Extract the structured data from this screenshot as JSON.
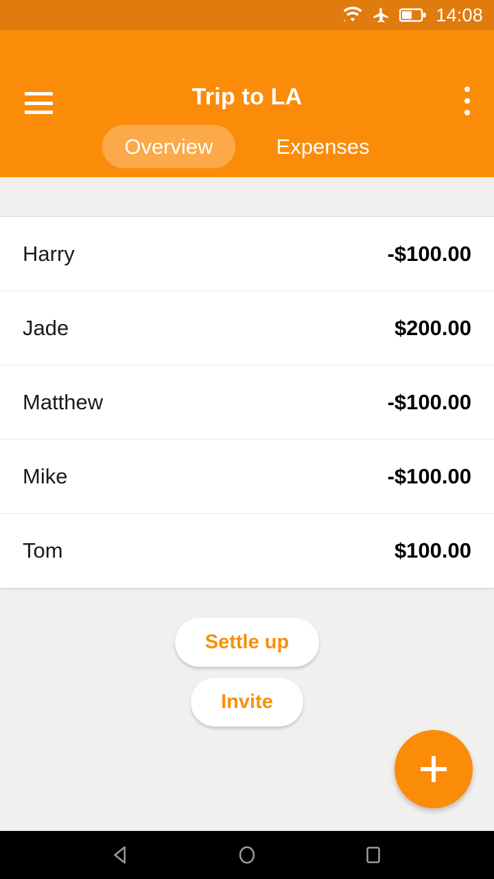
{
  "status_bar": {
    "time": "14:08",
    "icons": [
      "wifi-icon",
      "airplane-mode-icon",
      "battery-icon"
    ],
    "background": "#E07B0E"
  },
  "app_bar": {
    "title": "Trip to LA",
    "menu_icon": "hamburger-menu-icon",
    "overflow_icon": "overflow-menu-icon",
    "background": "#FB8C0A",
    "tabs": [
      {
        "label": "Overview",
        "selected": true
      },
      {
        "label": "Expenses",
        "selected": false
      }
    ]
  },
  "balances": {
    "rows": [
      {
        "name": "Harry",
        "amount": "-$100.00"
      },
      {
        "name": "Jade",
        "amount": "$200.00"
      },
      {
        "name": "Matthew",
        "amount": "-$100.00"
      },
      {
        "name": "Mike",
        "amount": "-$100.00"
      },
      {
        "name": "Tom",
        "amount": "$100.00"
      }
    ]
  },
  "actions": {
    "settle_up_label": "Settle up",
    "invite_label": "Invite",
    "accent_color": "#F7900B"
  },
  "fab": {
    "icon": "plus-icon",
    "color": "#FB8C0A"
  },
  "nav_bar": {
    "back_icon": "back-triangle-icon",
    "home_icon": "home-circle-icon",
    "recents_icon": "recents-square-icon"
  }
}
